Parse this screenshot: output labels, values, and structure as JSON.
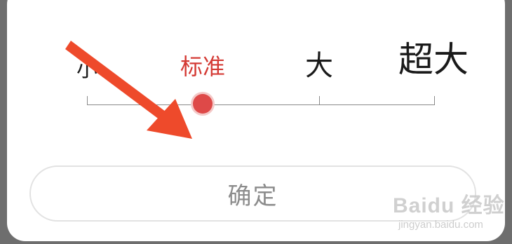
{
  "font_size_selector": {
    "options": [
      "小",
      "标准",
      "大",
      "超大"
    ],
    "selected": "标准",
    "selected_index": 1,
    "accent_color": "#de4948"
  },
  "confirm_button": {
    "label": "确定"
  },
  "annotation": {
    "arrow_color": "#ee4a2b",
    "icon": "arrow-icon"
  },
  "watermark": {
    "brand": "Baidu 经验",
    "url": "jingyan.baidu.com"
  }
}
